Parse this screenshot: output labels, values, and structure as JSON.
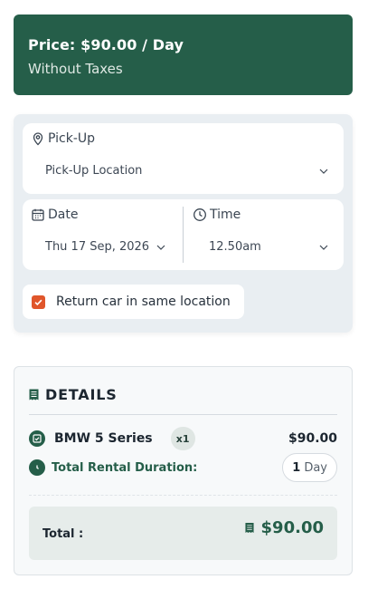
{
  "price": {
    "line": "Price: $90.00 / Day",
    "subtitle": "Without Taxes"
  },
  "pickup": {
    "label": "Pick-Up",
    "value": "Pick-Up Location"
  },
  "date": {
    "label": "Date",
    "value": "Thu 17 Sep, 2026"
  },
  "time": {
    "label": "Time",
    "value": "12.50am"
  },
  "return_same_location": {
    "label": "Return car in same location",
    "checked": true
  },
  "details": {
    "title": "DETAILS",
    "car": {
      "name": "BMW 5 Series",
      "quantity": "x1",
      "price": "$90.00"
    },
    "duration": {
      "label": "Total Rental Duration:",
      "count": "1",
      "unit": "Day"
    },
    "total": {
      "label": "Total :",
      "value": "$90.00"
    }
  },
  "colors": {
    "brand_green": "#255e49",
    "accent_orange": "#e0562b",
    "panel_bg": "#e9eef2"
  }
}
